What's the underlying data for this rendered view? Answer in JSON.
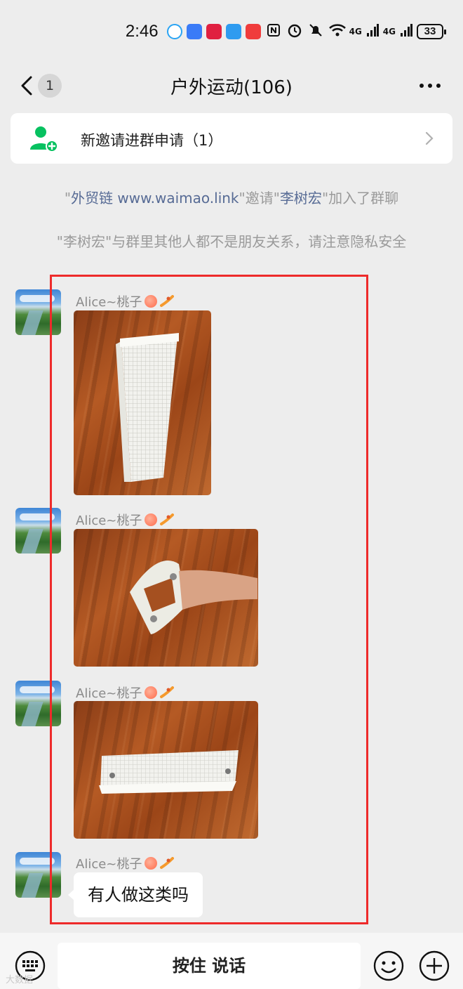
{
  "status_bar": {
    "time": "2:46",
    "network_1": "4G",
    "network_2": "4G",
    "battery": "33",
    "icons": [
      "qq-icon",
      "baidu-map-icon",
      "app-yh-icon",
      "weather-icon",
      "app-red-icon",
      "nfc-icon",
      "alarm-icon",
      "mute-icon",
      "wifi-icon",
      "signal-icon",
      "signal-icon"
    ]
  },
  "header": {
    "unread_count": "1",
    "title": "户外运动(106)"
  },
  "invite_banner": {
    "text": "新邀请进群申请（1）"
  },
  "system_messages": {
    "join": {
      "q1": "\"",
      "inviter": "外贸链 www.waimao.link",
      "mid": "\"邀请\"",
      "invitee": "李树宏",
      "end": "\"加入了群聊"
    },
    "privacy": "\"李树宏\"与群里其他人都不是朋友关系，请注意隐私安全"
  },
  "messages": [
    {
      "sender": "Alice~桃子",
      "type": "image",
      "image": "white-mesh-pouch-standing"
    },
    {
      "sender": "Alice~桃子",
      "type": "image",
      "image": "white-mesh-pouch-held-open"
    },
    {
      "sender": "Alice~桃子",
      "type": "image",
      "image": "white-mesh-pouch-lying-flat"
    },
    {
      "sender": "Alice~桃子",
      "type": "text",
      "text": "有人做这类吗"
    }
  ],
  "input_bar": {
    "hold_to_talk": "按住 说话"
  },
  "watermark": "大数据"
}
